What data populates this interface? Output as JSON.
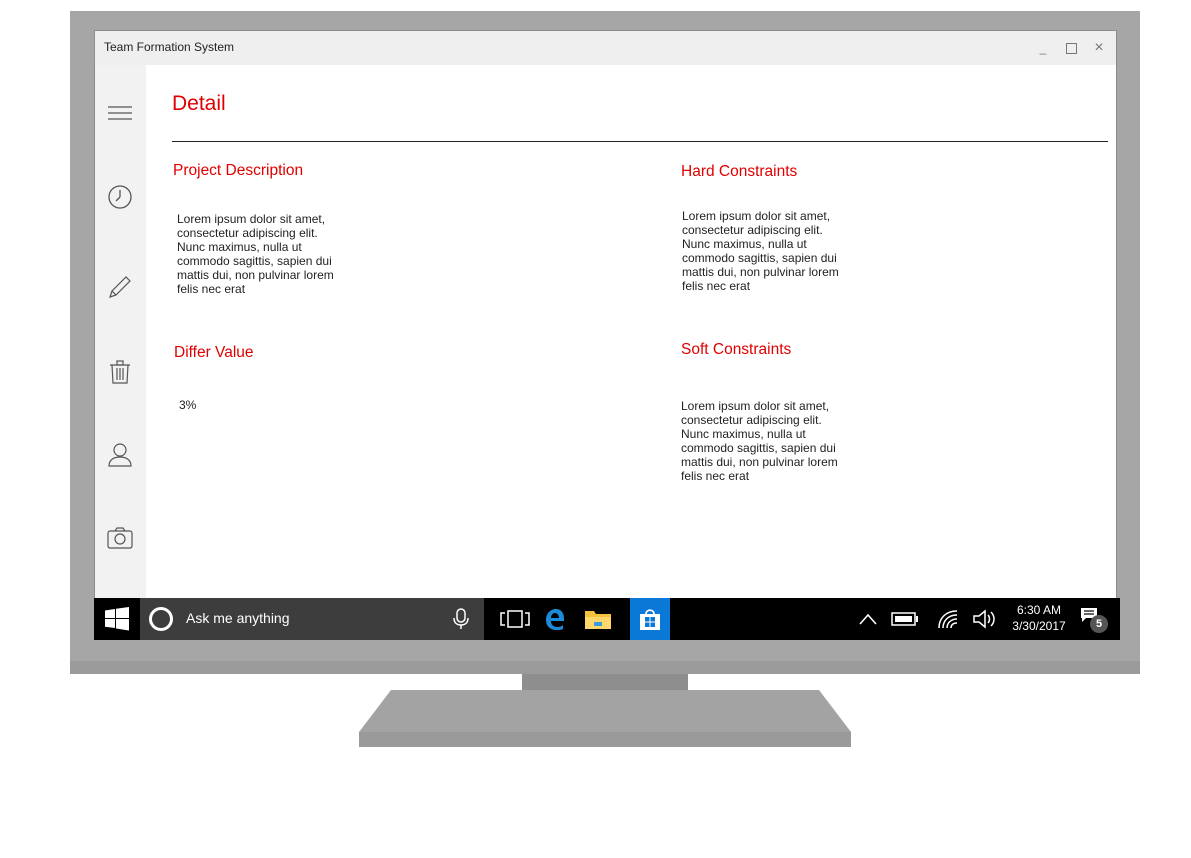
{
  "window": {
    "title": "Team Formation System",
    "minimize_glyph": "_",
    "maximize_glyph": "□",
    "close_glyph": "×"
  },
  "sidebar": {
    "items": [
      {
        "icon": "hamburger-menu-icon"
      },
      {
        "icon": "clock-icon"
      },
      {
        "icon": "pencil-icon"
      },
      {
        "icon": "trash-icon"
      },
      {
        "icon": "user-icon"
      },
      {
        "icon": "camera-icon"
      }
    ]
  },
  "page": {
    "title": "Detail",
    "project_description": {
      "heading": "Project Description",
      "lines": [
        "Lorem ipsum dolor sit amet,",
        "consectetur adipiscing elit.",
        "Nunc maximus, nulla ut",
        "commodo sagittis, sapien dui",
        "mattis dui, non pulvinar lorem",
        "felis nec erat"
      ]
    },
    "hard_constraints": {
      "heading": "Hard Constraints",
      "lines": [
        "Lorem ipsum dolor sit amet,",
        "consectetur adipiscing elit.",
        "Nunc maximus, nulla ut",
        "commodo sagittis, sapien dui",
        "mattis dui, non pulvinar lorem",
        "felis nec erat"
      ]
    },
    "differ_value": {
      "heading": "Differ Value",
      "value": "3%"
    },
    "soft_constraints": {
      "heading": "Soft Constraints",
      "lines": [
        "Lorem ipsum dolor sit amet,",
        "consectetur adipiscing elit.",
        "Nunc maximus, nulla ut",
        "commodo sagittis, sapien dui",
        "mattis dui, non pulvinar lorem",
        "felis nec erat"
      ]
    }
  },
  "taskbar": {
    "search_placeholder": "Ask me anything",
    "apps": [
      "task-view-icon",
      "edge-icon",
      "file-explorer-icon",
      "store-icon"
    ],
    "tray": [
      "chevron-up-icon",
      "battery-icon",
      "wifi-icon",
      "volume-icon"
    ],
    "time": "6:30 AM",
    "date": "3/30/2017",
    "notification_count": "5",
    "colors": {
      "store_bg": "#0a78d7",
      "search_bg": "#3d3d3d"
    }
  }
}
